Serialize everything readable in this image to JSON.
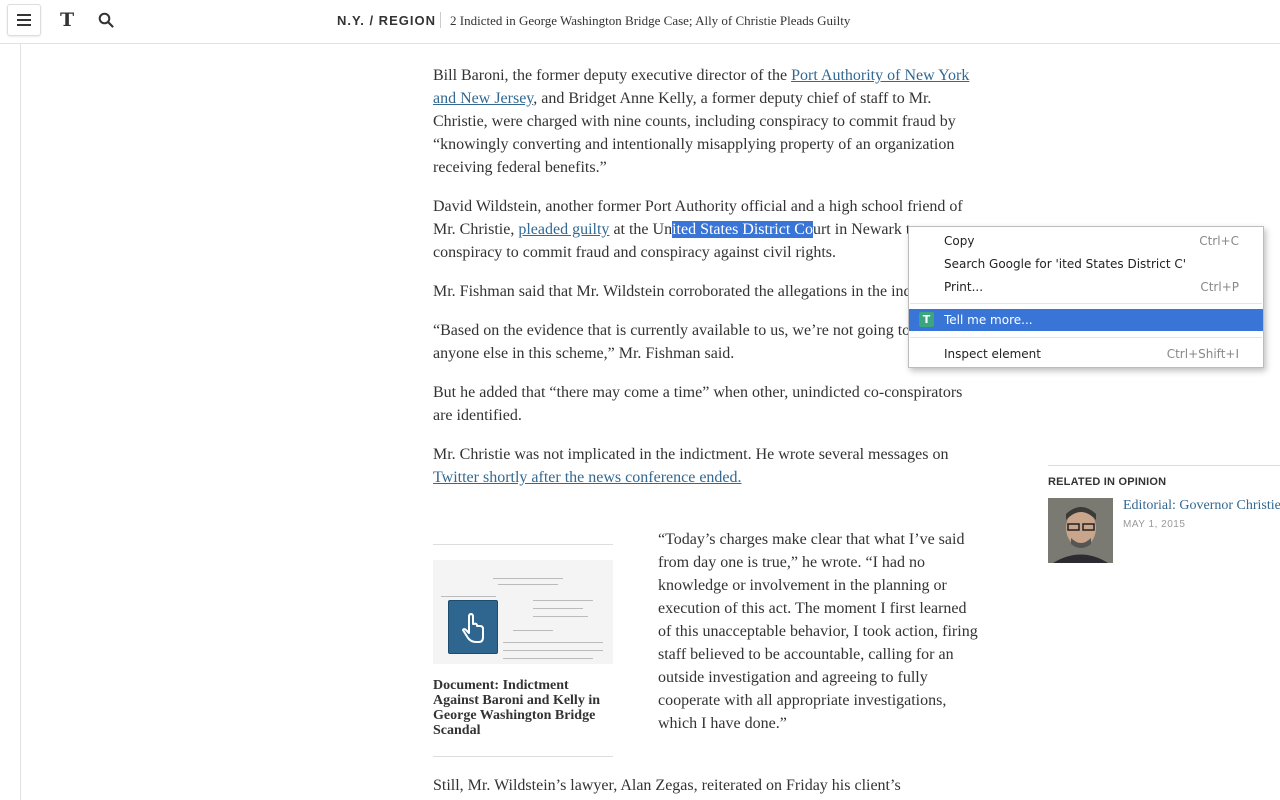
{
  "header": {
    "logo": "T",
    "section": "N.Y. / REGION",
    "headline": "2 Indicted in George Washington Bridge Case; Ally of Christie Pleads Guilty"
  },
  "article": {
    "p1": {
      "a": "Bill Baroni, the former deputy executive director of the ",
      "link": "Port Authority of New York and New Jersey",
      "b": ", and Bridget Anne Kelly, a former deputy chief of staff to Mr. Christie, were charged with nine counts, including conspiracy to commit fraud by “knowingly converting and intentionally misapplying property of an organization receiving federal benefits.”"
    },
    "p2": {
      "a": "David Wildstein, another former Port Authority official and a high school friend of Mr. Christie, ",
      "link": "pleaded guilty",
      "b": " at the Un",
      "selected": "ited States District Co",
      "c": "urt in Newark to conspiracy to commit fraud and conspiracy against civil rights."
    },
    "p3": "Mr. Fishman said that Mr. Wildstein corroborated the allegations in the indictment.",
    "p4": "“Based on the evidence that is currently available to us, we’re not going to charge anyone else in this scheme,” Mr. Fishman said.",
    "p5": "But he added that “there may come a time” when other, unindicted co-conspirators are identified.",
    "p6": {
      "a": "Mr. Christie was not implicated in the indictment. He wrote several messages on ",
      "link": "Twitter shortly after the news conference ended."
    },
    "quote": "“Today’s charges make clear that what I’ve said from day one is true,” he wrote. “I had no knowledge or involvement in the planning or execution of this act. The moment I first learned of this unacceptable behavior, I took action, firing staff believed to be accountable, calling for an outside investigation and agreeing to fully cooperate with all appropriate investigations, which I have done.”",
    "p7": "Still, Mr. Wildstein’s lawyer, Alan Zegas, reiterated on Friday his client’s"
  },
  "document": {
    "caption": "Document: Indictment Against Baroni and Kelly in George Washington Bridge Scandal"
  },
  "related": {
    "title": "RELATED IN OPINION",
    "item_link": "Editorial: Governor Christie",
    "item_date": "MAY 1, 2015"
  },
  "context_menu": {
    "items": [
      {
        "label": "Copy",
        "shortcut": "Ctrl+C"
      },
      {
        "label": "Search Google for 'ited States District C'",
        "shortcut": ""
      },
      {
        "label": "Print...",
        "shortcut": "Ctrl+P"
      },
      {
        "label": "Tell me more...",
        "shortcut": ""
      },
      {
        "label": "Inspect element",
        "shortcut": "Ctrl+Shift+I"
      }
    ]
  },
  "colors": {
    "link": "#326891",
    "selection": "#3875d7",
    "extension_icon": "#3aa57e"
  },
  "icons": [
    "menu-icon",
    "nyt-t-logo",
    "search-icon",
    "hand-pointer-icon",
    "extension-t-icon"
  ]
}
